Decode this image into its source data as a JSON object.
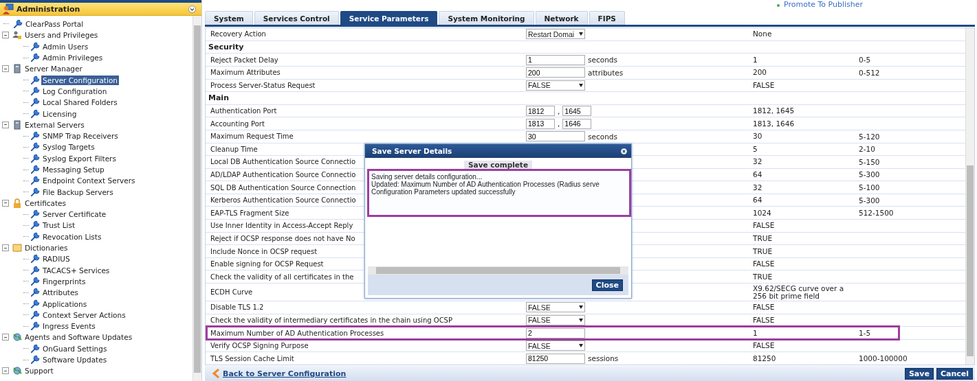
{
  "sidebar": {
    "title": "Administration",
    "items": [
      {
        "label": "ClearPass Portal",
        "kind": "page",
        "selected": false
      },
      {
        "label": "Users and Privileges",
        "kind": "users",
        "selected": false,
        "expanded": true,
        "children": [
          {
            "label": "Admin Users",
            "selected": false
          },
          {
            "label": "Admin Privileges",
            "selected": false
          }
        ]
      },
      {
        "label": "Server Manager",
        "kind": "server",
        "selected": false,
        "expanded": true,
        "children": [
          {
            "label": "Server Configuration",
            "selected": true
          },
          {
            "label": "Log Configuration",
            "selected": false
          },
          {
            "label": "Local Shared Folders",
            "selected": false
          },
          {
            "label": "Licensing",
            "selected": false
          }
        ]
      },
      {
        "label": "External Servers",
        "kind": "server",
        "selected": false,
        "expanded": true,
        "children": [
          {
            "label": "SNMP Trap Receivers",
            "selected": false
          },
          {
            "label": "Syslog Targets",
            "selected": false
          },
          {
            "label": "Syslog Export Filters",
            "selected": false
          },
          {
            "label": "Messaging Setup",
            "selected": false
          },
          {
            "label": "Endpoint Context Servers",
            "selected": false
          },
          {
            "label": "File Backup Servers",
            "selected": false
          }
        ]
      },
      {
        "label": "Certificates",
        "kind": "lock",
        "selected": false,
        "expanded": true,
        "children": [
          {
            "label": "Server Certificate",
            "selected": false
          },
          {
            "label": "Trust List",
            "selected": false
          },
          {
            "label": "Revocation Lists",
            "selected": false
          }
        ]
      },
      {
        "label": "Dictionaries",
        "kind": "book",
        "selected": false,
        "expanded": true,
        "children": [
          {
            "label": "RADIUS",
            "selected": false
          },
          {
            "label": "TACACS+ Services",
            "selected": false
          },
          {
            "label": "Fingerprints",
            "selected": false
          },
          {
            "label": "Attributes",
            "selected": false
          },
          {
            "label": "Applications",
            "selected": false
          },
          {
            "label": "Context Server Actions",
            "selected": false
          },
          {
            "label": "Ingress Events",
            "selected": false
          }
        ]
      },
      {
        "label": "Agents and Software Updates",
        "kind": "update",
        "selected": false,
        "expanded": true,
        "children": [
          {
            "label": "OnGuard Settings",
            "selected": false
          },
          {
            "label": "Software Updates",
            "selected": false
          }
        ]
      },
      {
        "label": "Support",
        "kind": "update",
        "selected": false,
        "expanded": true
      }
    ]
  },
  "header_link": "Promote To Publisher",
  "tabs": [
    {
      "label": "System",
      "selected": false
    },
    {
      "label": "Services Control",
      "selected": false
    },
    {
      "label": "Service Parameters",
      "selected": true
    },
    {
      "label": "System Monitoring",
      "selected": false
    },
    {
      "label": "Network",
      "selected": false
    },
    {
      "label": "FIPS",
      "selected": false
    }
  ],
  "table": {
    "rows": [
      {
        "kind": "param",
        "label": "Recovery Action",
        "control": {
          "kind": "select",
          "value": "Restart Domai"
        },
        "default": "None",
        "highlighted": false
      },
      {
        "kind": "section",
        "label": "Security"
      },
      {
        "kind": "param",
        "label": "Reject Packet Delay",
        "control": {
          "kind": "input",
          "value": "1",
          "unit": "seconds"
        },
        "default": "1",
        "range": "0-5",
        "highlighted": false
      },
      {
        "kind": "param",
        "label": "Maximum Attributes",
        "control": {
          "kind": "input",
          "value": "200",
          "unit": "attributes"
        },
        "default": "200",
        "range": "0-512",
        "highlighted": false
      },
      {
        "kind": "param",
        "label": "Process Server-Status Request",
        "control": {
          "kind": "select",
          "value": "FALSE"
        },
        "default": "FALSE",
        "highlighted": false
      },
      {
        "kind": "section",
        "label": "Main"
      },
      {
        "kind": "param",
        "label": "Authentication Port",
        "control": {
          "kind": "pair",
          "values": [
            "1812",
            "1645"
          ],
          "separator": ","
        },
        "default": "1812, 1645",
        "highlighted": false
      },
      {
        "kind": "param",
        "label": "Accounting Port",
        "control": {
          "kind": "pair",
          "values": [
            "1813",
            "1646"
          ],
          "separator": ","
        },
        "default": "1813, 1646",
        "highlighted": false
      },
      {
        "kind": "param",
        "label": "Maximum Request Time",
        "control": {
          "kind": "input",
          "value": "30",
          "unit": "seconds"
        },
        "default": "30",
        "range": "5-120",
        "highlighted": false
      },
      {
        "kind": "param",
        "label": "Cleanup Time",
        "default": "5",
        "range": "2-10",
        "highlighted": false
      },
      {
        "kind": "param",
        "label": "Local DB Authentication Source Connectio",
        "default": "32",
        "range": "5-150",
        "highlighted": false
      },
      {
        "kind": "param",
        "label": "AD/LDAP Authentication Source Connectio",
        "default": "64",
        "range": "5-300",
        "highlighted": false
      },
      {
        "kind": "param",
        "label": "SQL DB Authentication Source Connection",
        "default": "32",
        "range": "5-100",
        "highlighted": false
      },
      {
        "kind": "param",
        "label": "Kerberos Authentication Source Connectio",
        "default": "64",
        "range": "5-300",
        "highlighted": false
      },
      {
        "kind": "param",
        "label": "EAP-TLS Fragment Size",
        "default": "1024",
        "range": "512-1500",
        "highlighted": false
      },
      {
        "kind": "param",
        "label": "Use Inner Identity in Access-Accept Reply",
        "default": "FALSE",
        "highlighted": false
      },
      {
        "kind": "param",
        "label": "Reject if OCSP response does not have No",
        "default": "TRUE",
        "highlighted": false
      },
      {
        "kind": "param",
        "label": "Include Nonce in OCSP request",
        "default": "TRUE",
        "highlighted": false
      },
      {
        "kind": "param",
        "label": "Enable signing for OCSP Request",
        "default": "FALSE",
        "highlighted": false
      },
      {
        "kind": "param",
        "label": "Check the validity of all certificates in the",
        "default": "TRUE",
        "highlighted": false
      },
      {
        "kind": "param",
        "label": "ECDH Curve",
        "default": "X9.62/SECG curve over a 256 bit prime field",
        "highlighted": false
      },
      {
        "kind": "param",
        "label": "Disable TLS 1.2",
        "control": {
          "kind": "select",
          "value": "FALSE"
        },
        "default": "FALSE",
        "highlighted": false
      },
      {
        "kind": "param",
        "label": "Check the validity of intermediary certificates in the chain using OCSP",
        "control": {
          "kind": "select",
          "value": "FALSE"
        },
        "default": "FALSE",
        "highlighted": false
      },
      {
        "kind": "param",
        "label": "Maximum Number of AD Authentication Processes",
        "control": {
          "kind": "input",
          "value": "2"
        },
        "default": "1",
        "range": "1-5",
        "highlighted": true
      },
      {
        "kind": "param",
        "label": "Verify OCSP Signing Purpose",
        "control": {
          "kind": "select",
          "value": "FALSE"
        },
        "default": "FALSE",
        "highlighted": false
      },
      {
        "kind": "param",
        "label": "TLS Session Cache Limit",
        "control": {
          "kind": "input",
          "value": "81250",
          "unit": "sessions"
        },
        "default": "81250",
        "range": "1000-100000",
        "highlighted": false
      }
    ]
  },
  "back_link": "Back to Server Configuration",
  "buttons": [
    "Save",
    "Cancel"
  ],
  "dialog": {
    "title": "Save Server Details",
    "status": "Save complete",
    "message": {
      "highlighted": true,
      "lines": [
        "Saving server details configuration...",
        "Updated: Maximum Number of AD Authentication Processes (Radius serve",
        "Configuration Parameters updated successfully"
      ]
    },
    "button": "Close"
  }
}
